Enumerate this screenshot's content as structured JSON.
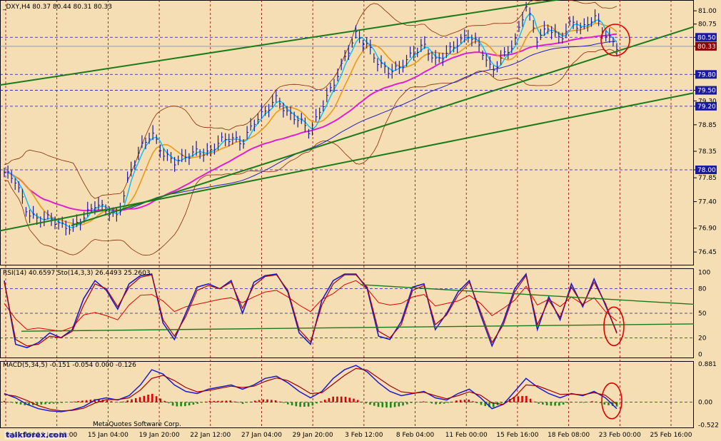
{
  "chart_data": {
    "type": "line",
    "symbol_header": "_DXY,H4  80.37 80.44 80.31 80.33",
    "price_axis": {
      "ticks": [
        "81.00",
        "80.75",
        "80.50",
        "80.33",
        "79.80",
        "79.50",
        "79.30",
        "79.20",
        "78.85",
        "78.35",
        "78.00",
        "77.85",
        "77.40",
        "76.90",
        "76.45"
      ],
      "highlighted": [
        {
          "label": "80.50",
          "color": "#1a1aa0"
        },
        {
          "label": "80.33",
          "color": "#8b0000"
        },
        {
          "label": "79.80",
          "color": "#1a1aa0"
        },
        {
          "label": "79.50",
          "color": "#1a1aa0"
        },
        {
          "label": "79.20",
          "color": "#1a1aa0"
        },
        {
          "label": "78.00",
          "color": "#1a1aa0"
        }
      ],
      "dashed_levels": [
        80.5,
        79.8,
        79.5,
        79.2,
        78.0
      ],
      "ylim": [
        76.25,
        81.15
      ]
    },
    "time_axis": [
      "8 Jan 2010",
      "13 Jan 12:00",
      "15 Jan 04:00",
      "19 Jan 20:00",
      "22 Jan 12:00",
      "27 Jan 04:00",
      "29 Jan 20:00",
      "3 Feb 12:00",
      "8 Feb 04:00",
      "11 Feb 00:00",
      "15 Feb 16:00",
      "18 Feb 08:00",
      "23 Feb 00:00",
      "25 Feb 16:00"
    ],
    "price_close": [
      77.95,
      77.8,
      77.2,
      77.05,
      77.1,
      76.95,
      76.9,
      77.1,
      77.35,
      77.25,
      77.1,
      77.9,
      78.4,
      78.7,
      78.3,
      78.15,
      78.25,
      78.35,
      78.3,
      78.55,
      78.6,
      78.5,
      78.9,
      79.1,
      79.35,
      79.05,
      78.95,
      78.7,
      79.2,
      79.6,
      80.1,
      80.55,
      80.35,
      80.0,
      79.85,
      79.95,
      80.2,
      80.35,
      80.05,
      80.2,
      80.4,
      80.55,
      80.3,
      79.85,
      80.15,
      80.4,
      81.1,
      80.45,
      80.7,
      80.45,
      80.8,
      80.65,
      80.9,
      80.55,
      80.33
    ],
    "series": [
      {
        "name": "RSI(14)",
        "last": "40.6597",
        "values": [
          62,
          43,
          30,
          32,
          30,
          28,
          33,
          48,
          51,
          47,
          42,
          60,
          72,
          73,
          65,
          52,
          58,
          61,
          64,
          67,
          69,
          63,
          70,
          76,
          78,
          70,
          60,
          52,
          67,
          74,
          85,
          90,
          80,
          63,
          60,
          62,
          70,
          73,
          59,
          62,
          65,
          72,
          62,
          47,
          56,
          66,
          83,
          60,
          67,
          58,
          70,
          61,
          69,
          52,
          40.66
        ]
      },
      {
        "name": "Sto(14,3,3)",
        "last": "26.4493",
        "values": [
          90,
          12,
          8,
          14,
          26,
          20,
          30,
          68,
          90,
          78,
          55,
          86,
          96,
          98,
          38,
          18,
          50,
          82,
          86,
          80,
          90,
          50,
          88,
          96,
          98,
          76,
          26,
          12,
          66,
          90,
          98,
          98,
          80,
          22,
          18,
          40,
          82,
          86,
          30,
          50,
          76,
          90,
          48,
          10,
          40,
          80,
          98,
          30,
          70,
          42,
          86,
          58,
          92,
          60,
          26.45
        ]
      },
      {
        "name": "Sto signal",
        "last": "25.2603",
        "values": [
          88,
          18,
          10,
          12,
          22,
          20,
          28,
          60,
          86,
          80,
          58,
          82,
          94,
          97,
          42,
          22,
          46,
          78,
          84,
          80,
          88,
          56,
          84,
          95,
          97,
          78,
          30,
          15,
          60,
          86,
          97,
          97,
          82,
          28,
          20,
          36,
          78,
          84,
          36,
          48,
          72,
          88,
          52,
          14,
          36,
          76,
          96,
          36,
          66,
          45,
          82,
          60,
          88,
          62,
          25.26
        ]
      }
    ],
    "rsi_panel": {
      "label": "RSI(14)  40.6597  Sto(14,3,3)  26.4493  25.2603",
      "ticks": [
        100,
        80,
        50,
        20,
        0
      ],
      "dashed_levels": [
        80,
        50,
        20
      ],
      "ylim": [
        -5,
        105
      ]
    },
    "macd": {
      "label": "MACD(5,34,5)  -0.151  -0.054  0.000  -0.126",
      "ticks": [
        "0.881",
        "0.00",
        "-0.522"
      ],
      "tick_values": [
        0.881,
        0,
        -0.522
      ],
      "ylim": [
        -0.6,
        0.95
      ],
      "main": [
        0.2,
        0.1,
        -0.05,
        -0.15,
        -0.2,
        -0.22,
        -0.18,
        -0.1,
        0.05,
        0.1,
        0.05,
        0.15,
        0.4,
        0.75,
        0.65,
        0.4,
        0.25,
        0.2,
        0.3,
        0.35,
        0.4,
        0.3,
        0.4,
        0.55,
        0.6,
        0.45,
        0.25,
        0.1,
        0.25,
        0.55,
        0.75,
        0.85,
        0.7,
        0.45,
        0.25,
        0.15,
        0.2,
        0.25,
        0.1,
        0.05,
        0.2,
        0.3,
        0.1,
        -0.15,
        -0.05,
        0.25,
        0.55,
        0.35,
        0.2,
        0.1,
        0.2,
        0.15,
        0.25,
        0.1,
        -0.15
      ],
      "signal": [
        0.18,
        0.14,
        0.04,
        -0.08,
        -0.16,
        -0.2,
        -0.19,
        -0.14,
        -0.02,
        0.06,
        0.06,
        0.1,
        0.28,
        0.55,
        0.62,
        0.5,
        0.34,
        0.24,
        0.27,
        0.32,
        0.37,
        0.34,
        0.37,
        0.48,
        0.56,
        0.5,
        0.36,
        0.2,
        0.22,
        0.42,
        0.62,
        0.78,
        0.74,
        0.56,
        0.38,
        0.24,
        0.21,
        0.23,
        0.15,
        0.08,
        0.15,
        0.24,
        0.16,
        -0.02,
        -0.05,
        0.12,
        0.4,
        0.38,
        0.28,
        0.18,
        0.19,
        0.17,
        0.22,
        0.16,
        -0.05
      ],
      "histogram": [
        0.03,
        -0.03,
        -0.08,
        -0.06,
        -0.04,
        -0.02,
        0.01,
        0.04,
        0.07,
        0.05,
        -0.02,
        0.05,
        0.12,
        0.2,
        0.05,
        -0.1,
        -0.09,
        -0.04,
        0.03,
        0.03,
        0.04,
        -0.04,
        0.03,
        0.07,
        0.04,
        -0.05,
        -0.11,
        -0.1,
        0.03,
        0.13,
        0.13,
        0.07,
        -0.04,
        -0.11,
        -0.13,
        -0.09,
        -0.01,
        0.02,
        -0.05,
        -0.03,
        0.05,
        0.06,
        -0.06,
        -0.13,
        0.0,
        0.13,
        0.15,
        -0.03,
        -0.08,
        -0.08,
        0.01,
        -0.02,
        0.03,
        -0.06,
        -0.1
      ]
    },
    "colors": {
      "background": "#f5deb3",
      "price_bars": "#1a1aa0",
      "ma_fast": "#00bfff",
      "ma_orange": "#e89a1a",
      "ma_magenta": "#e020d0",
      "ma_blue": "#2020c0",
      "bollinger": "#8b2500",
      "trendline": "#1a7a1a",
      "rsi": "#e00000",
      "stochastic": "#1a1ad0",
      "sto_signal": "#b00000",
      "macd_main": "#1a1ad0",
      "macd_signal": "#a00000",
      "hist_up": "#e00000",
      "hist_down": "#1a8a1a",
      "annotation": "#e00000"
    },
    "grid": true
  },
  "watermark": "talkforex.com",
  "footer_partial": "MetaQuotes Software Corp."
}
